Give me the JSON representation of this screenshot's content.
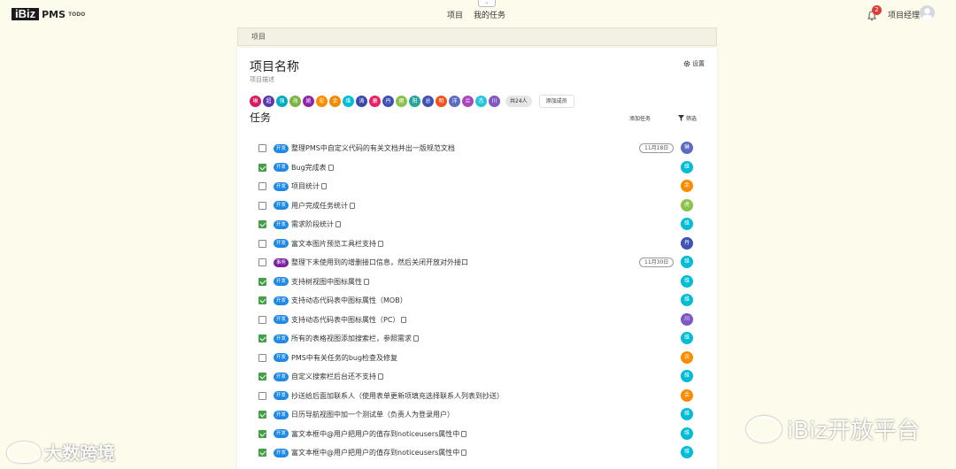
{
  "header": {
    "logo_text": "iBiz",
    "app_name": "PMS",
    "app_sub": "TODO",
    "nav": [
      "项目",
      "我的任务"
    ],
    "notification_count": "2",
    "user_name": "项目经理"
  },
  "breadcrumb": "项目",
  "project": {
    "title": "项目名称",
    "description": "项目描述",
    "settings_label": "设置"
  },
  "members": {
    "list": [
      {
        "char": "琳",
        "color": "#d81b60"
      },
      {
        "char": "超",
        "color": "#5e35b1"
      },
      {
        "char": "强",
        "color": "#00acc1"
      },
      {
        "char": "海",
        "color": "#7cb342"
      },
      {
        "char": "姚",
        "color": "#8e24aa"
      },
      {
        "char": "宏",
        "color": "#fb8c00"
      },
      {
        "char": "余",
        "color": "#ef8a00"
      },
      {
        "char": "维",
        "color": "#00bcd4"
      },
      {
        "char": "涛",
        "color": "#3949ab"
      },
      {
        "char": "康",
        "color": "#e91e63"
      },
      {
        "char": "丹",
        "color": "#3f51b5"
      },
      {
        "char": "雨",
        "color": "#8bc34a"
      },
      {
        "char": "阳",
        "color": "#26a69a"
      },
      {
        "char": "总",
        "color": "#3f51b5"
      },
      {
        "char": "明",
        "color": "#f4511e"
      },
      {
        "char": "洋",
        "color": "#5c6bc0"
      },
      {
        "char": "兰",
        "color": "#ab47bc"
      },
      {
        "char": "杰",
        "color": "#26c6da"
      },
      {
        "char": "川",
        "color": "#7e57c2"
      }
    ],
    "count_label": "共24人",
    "add_label": "添加成员"
  },
  "tasks_section": {
    "title": "任务",
    "add_label": "添加任务",
    "filter_label": "筛选"
  },
  "tasks": [
    {
      "done": false,
      "tag": "开发",
      "tag_type": "dev",
      "name": "整理PMS中自定义代码的有关文档并出一版规范文档",
      "doc": false,
      "date": "11月18日",
      "avatar": "琳",
      "avatar_color": "#5c6bc0"
    },
    {
      "done": true,
      "tag": "开发",
      "tag_type": "dev",
      "name": "Bug完成表",
      "doc": true,
      "date": "",
      "avatar": "维",
      "avatar_color": "#00bcd4"
    },
    {
      "done": false,
      "tag": "开发",
      "tag_type": "dev",
      "name": "项目统计",
      "doc": true,
      "date": "",
      "avatar": "余",
      "avatar_color": "#fb8c00"
    },
    {
      "done": false,
      "tag": "开发",
      "tag_type": "dev",
      "name": "用户完成任务统计",
      "doc": true,
      "date": "",
      "avatar": "虎",
      "avatar_color": "#8bc34a"
    },
    {
      "done": true,
      "tag": "开发",
      "tag_type": "dev",
      "name": "需求阶段统计",
      "doc": true,
      "date": "",
      "avatar": "维",
      "avatar_color": "#00bcd4"
    },
    {
      "done": false,
      "tag": "开发",
      "tag_type": "dev",
      "name": "富文本图片预览工具栏支持",
      "doc": true,
      "date": "",
      "avatar": "丹",
      "avatar_color": "#3f51b5"
    },
    {
      "done": false,
      "tag": "事务",
      "tag_type": "affair",
      "name": "整理下未使用到的增删接口信息，然后关闭开放对外接口",
      "doc": false,
      "date": "11月30日",
      "avatar": "维",
      "avatar_color": "#00bcd4"
    },
    {
      "done": true,
      "tag": "开发",
      "tag_type": "dev",
      "name": "支持树视图中图标属性",
      "doc": true,
      "date": "",
      "avatar": "维",
      "avatar_color": "#00bcd4"
    },
    {
      "done": true,
      "tag": "开发",
      "tag_type": "dev",
      "name": "支持动态代码表中图标属性（MOB）",
      "doc": false,
      "date": "",
      "avatar": "维",
      "avatar_color": "#00bcd4"
    },
    {
      "done": false,
      "tag": "开发",
      "tag_type": "dev",
      "name": "支持动态代码表中图标属性（PC）",
      "doc": true,
      "date": "",
      "avatar": "川",
      "avatar_color": "#7e57c2"
    },
    {
      "done": true,
      "tag": "开发",
      "tag_type": "dev",
      "name": "所有的表格视图添加搜索栏，参照需求",
      "doc": true,
      "date": "",
      "avatar": "维",
      "avatar_color": "#00bcd4"
    },
    {
      "done": false,
      "tag": "开发",
      "tag_type": "dev",
      "name": "PMS中有关任务的bug检查及修复",
      "doc": false,
      "date": "",
      "avatar": "余",
      "avatar_color": "#fb8c00"
    },
    {
      "done": true,
      "tag": "开发",
      "tag_type": "dev",
      "name": "自定义搜索栏后台还不支持",
      "doc": true,
      "date": "",
      "avatar": "维",
      "avatar_color": "#00bcd4"
    },
    {
      "done": false,
      "tag": "开发",
      "tag_type": "dev",
      "name": "抄送给后面加联系人（使用表单更新项填充选择联系人列表到抄送）",
      "doc": false,
      "date": "",
      "avatar": "余",
      "avatar_color": "#fb8c00"
    },
    {
      "done": true,
      "tag": "开发",
      "tag_type": "dev",
      "name": "日历导航视图中加一个测试单（负责人为登录用户）",
      "doc": false,
      "date": "",
      "avatar": "维",
      "avatar_color": "#00bcd4"
    },
    {
      "done": true,
      "tag": "开发",
      "tag_type": "dev",
      "name": "富文本框中@用户把用户的值存到noticeusers属性中",
      "doc": true,
      "date": "",
      "avatar": "维",
      "avatar_color": "#00bcd4"
    },
    {
      "done": true,
      "tag": "开发",
      "tag_type": "dev",
      "name": "富文本框中@用户把用户的值存到noticeusers属性中",
      "doc": true,
      "date": "",
      "avatar": "维",
      "avatar_color": "#00bcd4"
    }
  ],
  "watermarks": {
    "left": "大数跨境",
    "right": "iBiz开放平台"
  }
}
